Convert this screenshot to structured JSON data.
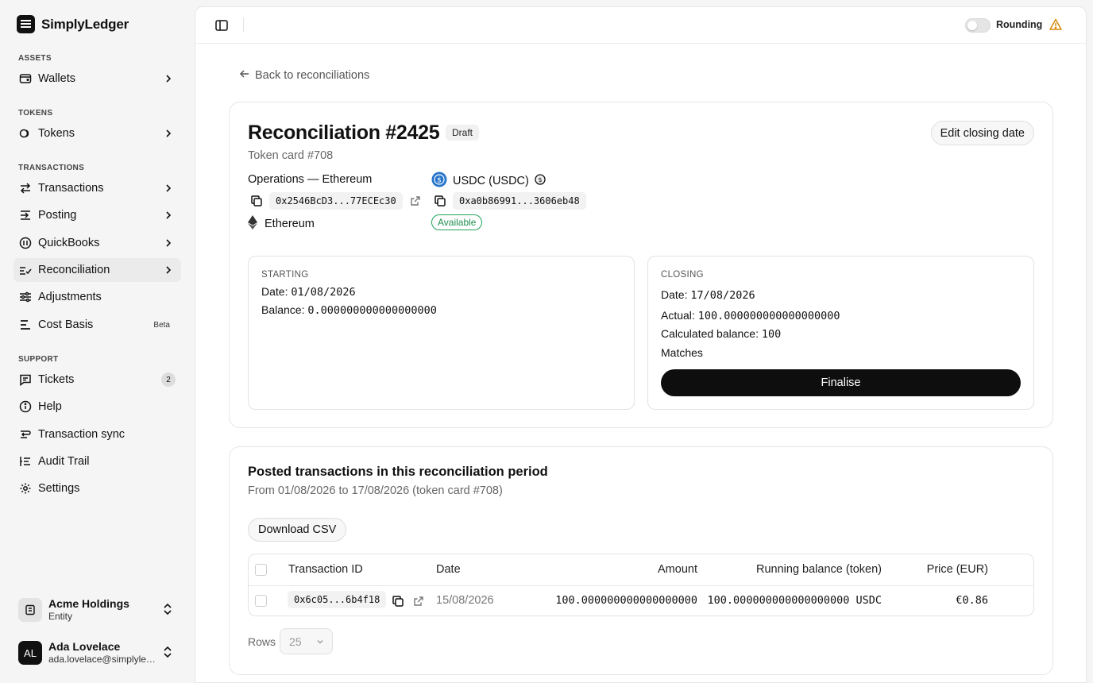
{
  "app": {
    "name": "SimplyLedger"
  },
  "sidebar": {
    "sections": {
      "assets": "ASSETS",
      "tokens": "TOKENS",
      "transactions": "TRANSACTIONS",
      "support": "SUPPORT"
    },
    "items": {
      "wallets": "Wallets",
      "tokens": "Tokens",
      "transactions": "Transactions",
      "posting": "Posting",
      "quickbooks": "QuickBooks",
      "reconciliation": "Reconciliation",
      "adjustments": "Adjustments",
      "cost_basis": "Cost Basis",
      "cost_basis_badge": "Beta",
      "tickets": "Tickets",
      "tickets_count": "2",
      "help": "Help",
      "transaction_sync": "Transaction sync",
      "audit_trail": "Audit Trail",
      "settings": "Settings"
    },
    "entity": {
      "name": "Acme Holdings",
      "type": "Entity"
    },
    "user": {
      "initials": "AL",
      "name": "Ada Lovelace",
      "email": "ada.lovelace@simplyledger.com"
    }
  },
  "topbar": {
    "rounding_label": "Rounding",
    "rounding_on": false,
    "warning_color": "#d98a0b"
  },
  "back_link": "Back to reconciliations",
  "reconciliation": {
    "title": "Reconciliation #2425",
    "status": "Draft",
    "edit_button": "Edit closing date",
    "subtitle": "Token card #708",
    "wallet_name": "Operations — Ethereum",
    "wallet_address": "0x2546BcD3...77ECEc30",
    "chain": "Ethereum",
    "token_name": "USDC (USDC)",
    "token_address": "0xa0b86991...3606eb48",
    "token_status": "Available",
    "starting": {
      "label": "STARTING",
      "date_label": "Date:",
      "date": "01/08/2026",
      "balance_label": "Balance:",
      "balance": "0.000000000000000000"
    },
    "closing": {
      "label": "CLOSING",
      "date_label": "Date:",
      "date": "17/08/2026",
      "actual_label": "Actual:",
      "actual": "100.000000000000000000",
      "calc_label": "Calculated balance:",
      "calc": "100",
      "match_status": "Matches",
      "finalise_button": "Finalise"
    }
  },
  "posted": {
    "title": "Posted transactions in this reconciliation period",
    "subtitle": "From 01/08/2026 to 17/08/2026 (token card #708)",
    "download_button": "Download CSV",
    "columns": {
      "tx_id": "Transaction ID",
      "date": "Date",
      "amount": "Amount",
      "running": "Running balance (token)",
      "price": "Price (EUR)"
    },
    "rows": [
      {
        "tx_id": "0x6c05...6b4f18",
        "date": "15/08/2026",
        "amount": "100.000000000000000000",
        "running": "100.000000000000000000 USDC",
        "price": "€0.86"
      }
    ],
    "rows_label": "Rows",
    "rows_value": "25"
  }
}
